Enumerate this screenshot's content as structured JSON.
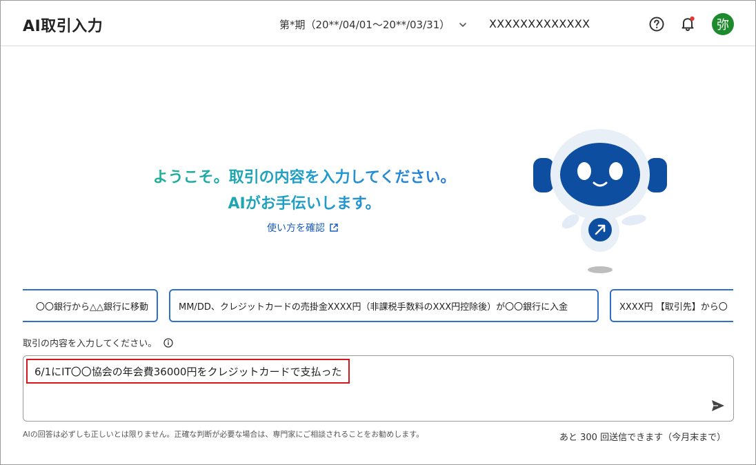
{
  "header": {
    "title": "AI取引入力",
    "period": "第*期（20**/04/01〜20**/03/31）",
    "company": "XXXXXXXXXXXXX",
    "avatar_char": "弥",
    "icons": {
      "help": "help-circle-icon",
      "bell": "bell-icon",
      "chevron": "chevron-down-icon"
    },
    "colors": {
      "avatar": "#1e8a2e",
      "notification_dot": "#e53935"
    }
  },
  "welcome": {
    "line1": "ようこそ。取引の内容を入力してください。",
    "line2": "AIがお手伝いします。",
    "howto_link": "使い方を確認",
    "icons": {
      "howto": "external-link-icon"
    }
  },
  "robot": {
    "icon": "robot-mascot-icon",
    "colors": {
      "body": "#0e4ea1",
      "face": "#e9eff7"
    }
  },
  "suggestions": [
    "〇〇銀行から△△銀行に移動",
    "MM/DD、クレジットカードの売掛金XXXX円（非課税手数料のXXX円控除後）が〇〇銀行に入金",
    "XXXX円 【取引先】から〇"
  ],
  "input": {
    "label": "取引の内容を入力してください。",
    "value": "6/1にIT〇〇協会の年会費36000円をクレジットカードで支払った",
    "icons": {
      "info": "info-icon",
      "send": "send-icon"
    },
    "colors": {
      "highlight_border": "#d2161b",
      "chip_border": "#2f6fc4"
    }
  },
  "footer": {
    "disclaimer": "AIの回答は必ずしも正しいとは限りません。正確な判断が必要な場合は、専門家にご相談されることをお勧めします。",
    "remaining": "あと 300 回送信できます（今月末まで）"
  }
}
